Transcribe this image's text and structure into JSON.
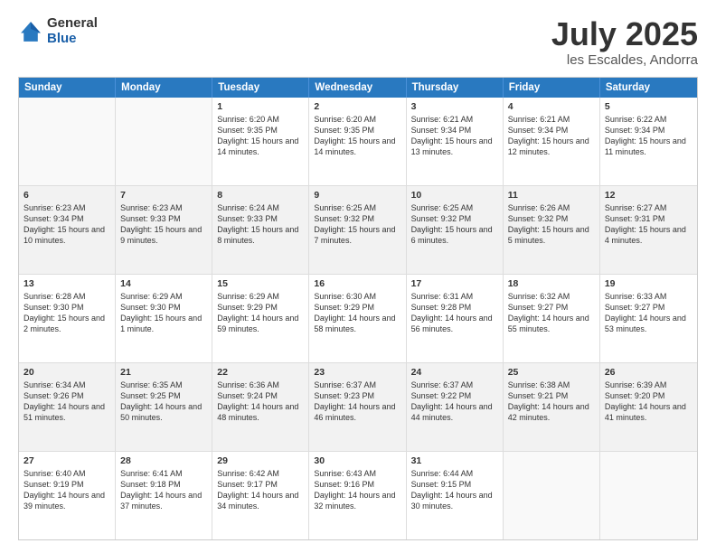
{
  "logo": {
    "general": "General",
    "blue": "Blue"
  },
  "title": "July 2025",
  "location": "les Escaldes, Andorra",
  "header_days": [
    "Sunday",
    "Monday",
    "Tuesday",
    "Wednesday",
    "Thursday",
    "Friday",
    "Saturday"
  ],
  "rows": [
    [
      {
        "day": "",
        "sunrise": "",
        "sunset": "",
        "daylight": ""
      },
      {
        "day": "",
        "sunrise": "",
        "sunset": "",
        "daylight": ""
      },
      {
        "day": "1",
        "sunrise": "Sunrise: 6:20 AM",
        "sunset": "Sunset: 9:35 PM",
        "daylight": "Daylight: 15 hours and 14 minutes."
      },
      {
        "day": "2",
        "sunrise": "Sunrise: 6:20 AM",
        "sunset": "Sunset: 9:35 PM",
        "daylight": "Daylight: 15 hours and 14 minutes."
      },
      {
        "day": "3",
        "sunrise": "Sunrise: 6:21 AM",
        "sunset": "Sunset: 9:34 PM",
        "daylight": "Daylight: 15 hours and 13 minutes."
      },
      {
        "day": "4",
        "sunrise": "Sunrise: 6:21 AM",
        "sunset": "Sunset: 9:34 PM",
        "daylight": "Daylight: 15 hours and 12 minutes."
      },
      {
        "day": "5",
        "sunrise": "Sunrise: 6:22 AM",
        "sunset": "Sunset: 9:34 PM",
        "daylight": "Daylight: 15 hours and 11 minutes."
      }
    ],
    [
      {
        "day": "6",
        "sunrise": "Sunrise: 6:23 AM",
        "sunset": "Sunset: 9:34 PM",
        "daylight": "Daylight: 15 hours and 10 minutes."
      },
      {
        "day": "7",
        "sunrise": "Sunrise: 6:23 AM",
        "sunset": "Sunset: 9:33 PM",
        "daylight": "Daylight: 15 hours and 9 minutes."
      },
      {
        "day": "8",
        "sunrise": "Sunrise: 6:24 AM",
        "sunset": "Sunset: 9:33 PM",
        "daylight": "Daylight: 15 hours and 8 minutes."
      },
      {
        "day": "9",
        "sunrise": "Sunrise: 6:25 AM",
        "sunset": "Sunset: 9:32 PM",
        "daylight": "Daylight: 15 hours and 7 minutes."
      },
      {
        "day": "10",
        "sunrise": "Sunrise: 6:25 AM",
        "sunset": "Sunset: 9:32 PM",
        "daylight": "Daylight: 15 hours and 6 minutes."
      },
      {
        "day": "11",
        "sunrise": "Sunrise: 6:26 AM",
        "sunset": "Sunset: 9:32 PM",
        "daylight": "Daylight: 15 hours and 5 minutes."
      },
      {
        "day": "12",
        "sunrise": "Sunrise: 6:27 AM",
        "sunset": "Sunset: 9:31 PM",
        "daylight": "Daylight: 15 hours and 4 minutes."
      }
    ],
    [
      {
        "day": "13",
        "sunrise": "Sunrise: 6:28 AM",
        "sunset": "Sunset: 9:30 PM",
        "daylight": "Daylight: 15 hours and 2 minutes."
      },
      {
        "day": "14",
        "sunrise": "Sunrise: 6:29 AM",
        "sunset": "Sunset: 9:30 PM",
        "daylight": "Daylight: 15 hours and 1 minute."
      },
      {
        "day": "15",
        "sunrise": "Sunrise: 6:29 AM",
        "sunset": "Sunset: 9:29 PM",
        "daylight": "Daylight: 14 hours and 59 minutes."
      },
      {
        "day": "16",
        "sunrise": "Sunrise: 6:30 AM",
        "sunset": "Sunset: 9:29 PM",
        "daylight": "Daylight: 14 hours and 58 minutes."
      },
      {
        "day": "17",
        "sunrise": "Sunrise: 6:31 AM",
        "sunset": "Sunset: 9:28 PM",
        "daylight": "Daylight: 14 hours and 56 minutes."
      },
      {
        "day": "18",
        "sunrise": "Sunrise: 6:32 AM",
        "sunset": "Sunset: 9:27 PM",
        "daylight": "Daylight: 14 hours and 55 minutes."
      },
      {
        "day": "19",
        "sunrise": "Sunrise: 6:33 AM",
        "sunset": "Sunset: 9:27 PM",
        "daylight": "Daylight: 14 hours and 53 minutes."
      }
    ],
    [
      {
        "day": "20",
        "sunrise": "Sunrise: 6:34 AM",
        "sunset": "Sunset: 9:26 PM",
        "daylight": "Daylight: 14 hours and 51 minutes."
      },
      {
        "day": "21",
        "sunrise": "Sunrise: 6:35 AM",
        "sunset": "Sunset: 9:25 PM",
        "daylight": "Daylight: 14 hours and 50 minutes."
      },
      {
        "day": "22",
        "sunrise": "Sunrise: 6:36 AM",
        "sunset": "Sunset: 9:24 PM",
        "daylight": "Daylight: 14 hours and 48 minutes."
      },
      {
        "day": "23",
        "sunrise": "Sunrise: 6:37 AM",
        "sunset": "Sunset: 9:23 PM",
        "daylight": "Daylight: 14 hours and 46 minutes."
      },
      {
        "day": "24",
        "sunrise": "Sunrise: 6:37 AM",
        "sunset": "Sunset: 9:22 PM",
        "daylight": "Daylight: 14 hours and 44 minutes."
      },
      {
        "day": "25",
        "sunrise": "Sunrise: 6:38 AM",
        "sunset": "Sunset: 9:21 PM",
        "daylight": "Daylight: 14 hours and 42 minutes."
      },
      {
        "day": "26",
        "sunrise": "Sunrise: 6:39 AM",
        "sunset": "Sunset: 9:20 PM",
        "daylight": "Daylight: 14 hours and 41 minutes."
      }
    ],
    [
      {
        "day": "27",
        "sunrise": "Sunrise: 6:40 AM",
        "sunset": "Sunset: 9:19 PM",
        "daylight": "Daylight: 14 hours and 39 minutes."
      },
      {
        "day": "28",
        "sunrise": "Sunrise: 6:41 AM",
        "sunset": "Sunset: 9:18 PM",
        "daylight": "Daylight: 14 hours and 37 minutes."
      },
      {
        "day": "29",
        "sunrise": "Sunrise: 6:42 AM",
        "sunset": "Sunset: 9:17 PM",
        "daylight": "Daylight: 14 hours and 34 minutes."
      },
      {
        "day": "30",
        "sunrise": "Sunrise: 6:43 AM",
        "sunset": "Sunset: 9:16 PM",
        "daylight": "Daylight: 14 hours and 32 minutes."
      },
      {
        "day": "31",
        "sunrise": "Sunrise: 6:44 AM",
        "sunset": "Sunset: 9:15 PM",
        "daylight": "Daylight: 14 hours and 30 minutes."
      },
      {
        "day": "",
        "sunrise": "",
        "sunset": "",
        "daylight": ""
      },
      {
        "day": "",
        "sunrise": "",
        "sunset": "",
        "daylight": ""
      }
    ]
  ]
}
